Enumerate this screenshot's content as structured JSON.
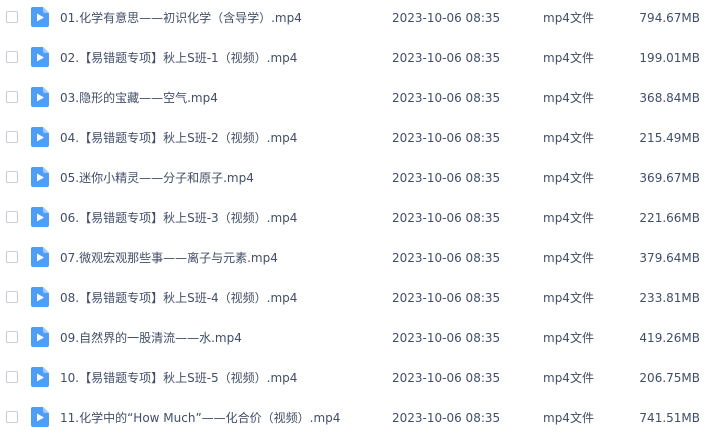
{
  "files": [
    {
      "name": "01.化学有意思——初识化学（含导学）.mp4",
      "date": "2023-10-06 08:35",
      "type": "mp4文件",
      "size": "794.67MB",
      "icon": "video-file-icon"
    },
    {
      "name": "02.【易错题专项】秋上S班-1（视频）.mp4",
      "date": "2023-10-06 08:35",
      "type": "mp4文件",
      "size": "199.01MB",
      "icon": "video-file-icon"
    },
    {
      "name": "03.隐形的宝藏——空气.mp4",
      "date": "2023-10-06 08:35",
      "type": "mp4文件",
      "size": "368.84MB",
      "icon": "video-file-icon"
    },
    {
      "name": "04.【易错题专项】秋上S班-2（视频）.mp4",
      "date": "2023-10-06 08:35",
      "type": "mp4文件",
      "size": "215.49MB",
      "icon": "video-file-icon"
    },
    {
      "name": "05.迷你小精灵——分子和原子.mp4",
      "date": "2023-10-06 08:35",
      "type": "mp4文件",
      "size": "369.67MB",
      "icon": "video-file-icon"
    },
    {
      "name": "06.【易错题专项】秋上S班-3（视频）.mp4",
      "date": "2023-10-06 08:35",
      "type": "mp4文件",
      "size": "221.66MB",
      "icon": "video-file-icon"
    },
    {
      "name": "07.微观宏观那些事——离子与元素.mp4",
      "date": "2023-10-06 08:35",
      "type": "mp4文件",
      "size": "379.64MB",
      "icon": "video-file-icon"
    },
    {
      "name": "08.【易错题专项】秋上S班-4（视频）.mp4",
      "date": "2023-10-06 08:35",
      "type": "mp4文件",
      "size": "233.81MB",
      "icon": "video-file-icon"
    },
    {
      "name": "09.自然界的一股清流——水.mp4",
      "date": "2023-10-06 08:35",
      "type": "mp4文件",
      "size": "419.26MB",
      "icon": "video-file-icon"
    },
    {
      "name": "10.【易错题专项】秋上S班-5（视频）.mp4",
      "date": "2023-10-06 08:35",
      "type": "mp4文件",
      "size": "206.75MB",
      "icon": "video-file-icon"
    },
    {
      "name": "11.化学中的“How Much”——化合价（视频）.mp4",
      "date": "2023-10-06 08:35",
      "type": "mp4文件",
      "size": "741.51MB",
      "icon": "video-file-icon"
    }
  ],
  "colors": {
    "text": "#424e67",
    "icon_fill": "#4e9df6",
    "icon_fold": "#9fcbfb",
    "checkbox_border": "#c7ccd6"
  }
}
